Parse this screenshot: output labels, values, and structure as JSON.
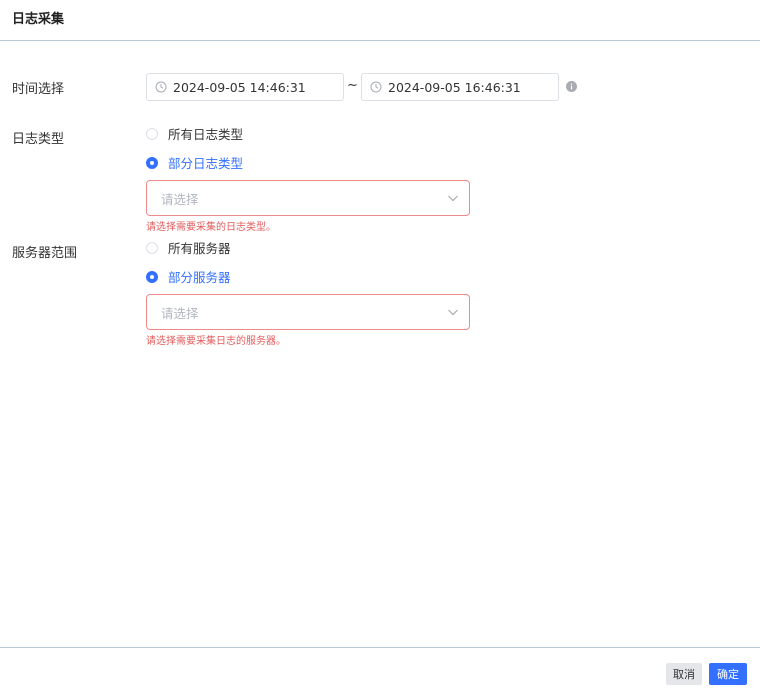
{
  "dialog": {
    "title": "日志采集"
  },
  "form": {
    "time": {
      "label": "时间选择",
      "start": "2024-09-05 14:46:31",
      "end": "2024-09-05 16:46:31",
      "separator": "~"
    },
    "log_type": {
      "label": "日志类型",
      "options": [
        "所有日志类型",
        "部分日志类型"
      ],
      "selected_index": 1,
      "select_placeholder": "请选择",
      "error": "请选择需要采集的日志类型。"
    },
    "server_scope": {
      "label": "服务器范围",
      "options": [
        "所有服务器",
        "部分服务器"
      ],
      "selected_index": 1,
      "select_placeholder": "请选择",
      "error": "请选择需要采集日志的服务器。"
    }
  },
  "footer": {
    "cancel_label": "取消",
    "confirm_label": "确定"
  },
  "icons": {
    "clock": "clock-icon",
    "info": "info-icon",
    "chevron": "chevron-down-icon"
  },
  "colors": {
    "primary": "#3370ff",
    "error": "#e25c5c",
    "error_border": "#f08a8a"
  }
}
